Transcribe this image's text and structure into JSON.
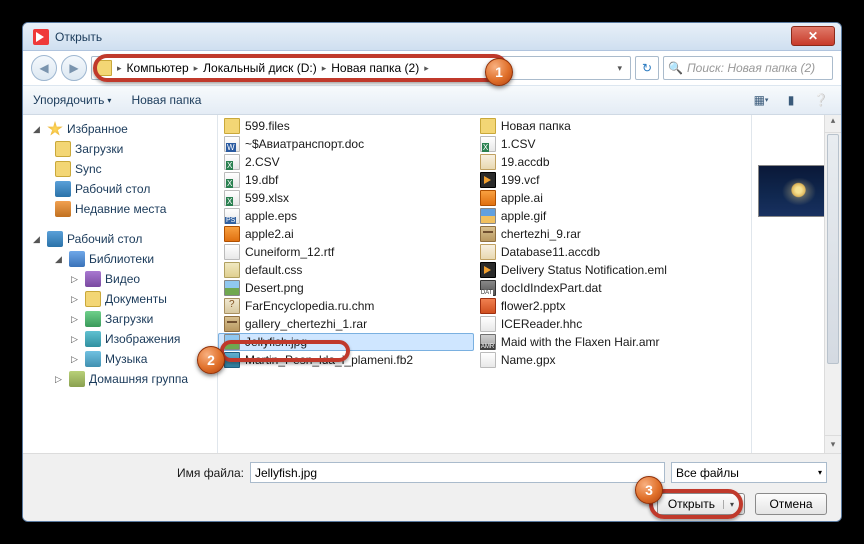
{
  "window": {
    "title": "Открыть",
    "close_glyph": "✕"
  },
  "nav": {
    "back_glyph": "◀",
    "fwd_glyph": "▶",
    "refresh_glyph": "↻"
  },
  "address": {
    "crumbs": [
      "Компьютер",
      "Локальный диск (D:)",
      "Новая папка (2)"
    ],
    "chev": "▸",
    "drop": "▾"
  },
  "search": {
    "placeholder": "Поиск: Новая папка (2)",
    "icon_glyph": "🔍"
  },
  "toolbar": {
    "organize": "Упорядочить",
    "newfolder": "Новая папка",
    "drop": "▾",
    "views_glyph": "▦",
    "preview_glyph": "▮",
    "help_glyph": "❔"
  },
  "tree": {
    "expand": "▷",
    "collapse": "◢",
    "favorites": "Избранное",
    "fav_items": [
      "Загрузки",
      "Sync",
      "Рабочий стол",
      "Недавние места"
    ],
    "desktop": "Рабочий стол",
    "libraries": "Библиотеки",
    "lib_items": [
      "Видео",
      "Документы",
      "Загрузки",
      "Изображения",
      "Музыка"
    ],
    "homegroup": "Домашняя группа"
  },
  "files": {
    "col1": [
      {
        "n": "599.files",
        "t": "fold"
      },
      {
        "n": "~$Авиатранспорт.doc",
        "t": "word"
      },
      {
        "n": "2.CSV",
        "t": "xl"
      },
      {
        "n": "19.dbf",
        "t": "xl"
      },
      {
        "n": "599.xlsx",
        "t": "xl"
      },
      {
        "n": "apple.eps",
        "t": "eps"
      },
      {
        "n": "apple2.ai",
        "t": "ai"
      },
      {
        "n": "Cuneiform_12.rtf",
        "t": "doc"
      },
      {
        "n": "default.css",
        "t": "css"
      },
      {
        "n": "Desert.png",
        "t": "img"
      },
      {
        "n": "FarEncyclopedia.ru.chm",
        "t": "chm"
      },
      {
        "n": "gallery_chertezhi_1.rar",
        "t": "rar"
      },
      {
        "n": "Jellyfish.jpg",
        "t": "img",
        "sel": true
      },
      {
        "n": "Martin_Pesn_lda_i_plameni.fb2",
        "t": "fb2"
      }
    ],
    "col2": [
      {
        "n": "Новая папка",
        "t": "fold"
      },
      {
        "n": "1.CSV",
        "t": "xl"
      },
      {
        "n": "19.accdb",
        "t": "db"
      },
      {
        "n": "199.vcf",
        "t": "vcf"
      },
      {
        "n": "apple.ai",
        "t": "ai"
      },
      {
        "n": "apple.gif",
        "t": "gif"
      },
      {
        "n": "chertezhi_9.rar",
        "t": "rar"
      },
      {
        "n": "Database11.accdb",
        "t": "db"
      },
      {
        "n": "Delivery Status Notification.eml",
        "t": "vcf"
      },
      {
        "n": "docIdIndexPart.dat",
        "t": "dat"
      },
      {
        "n": "flower2.pptx",
        "t": "pptx"
      },
      {
        "n": "ICEReader.hhc",
        "t": "doc"
      },
      {
        "n": "Maid with the Flaxen Hair.amr",
        "t": "amr"
      },
      {
        "n": "Name.gpx",
        "t": "gpx"
      }
    ]
  },
  "bottom": {
    "filename_label": "Имя файла:",
    "filename_value": "Jellyfish.jpg",
    "filter": "Все файлы",
    "filter_drop": "▾",
    "open": "Открыть",
    "cancel": "Отмена"
  },
  "markers": {
    "1": "1",
    "2": "2",
    "3": "3"
  }
}
